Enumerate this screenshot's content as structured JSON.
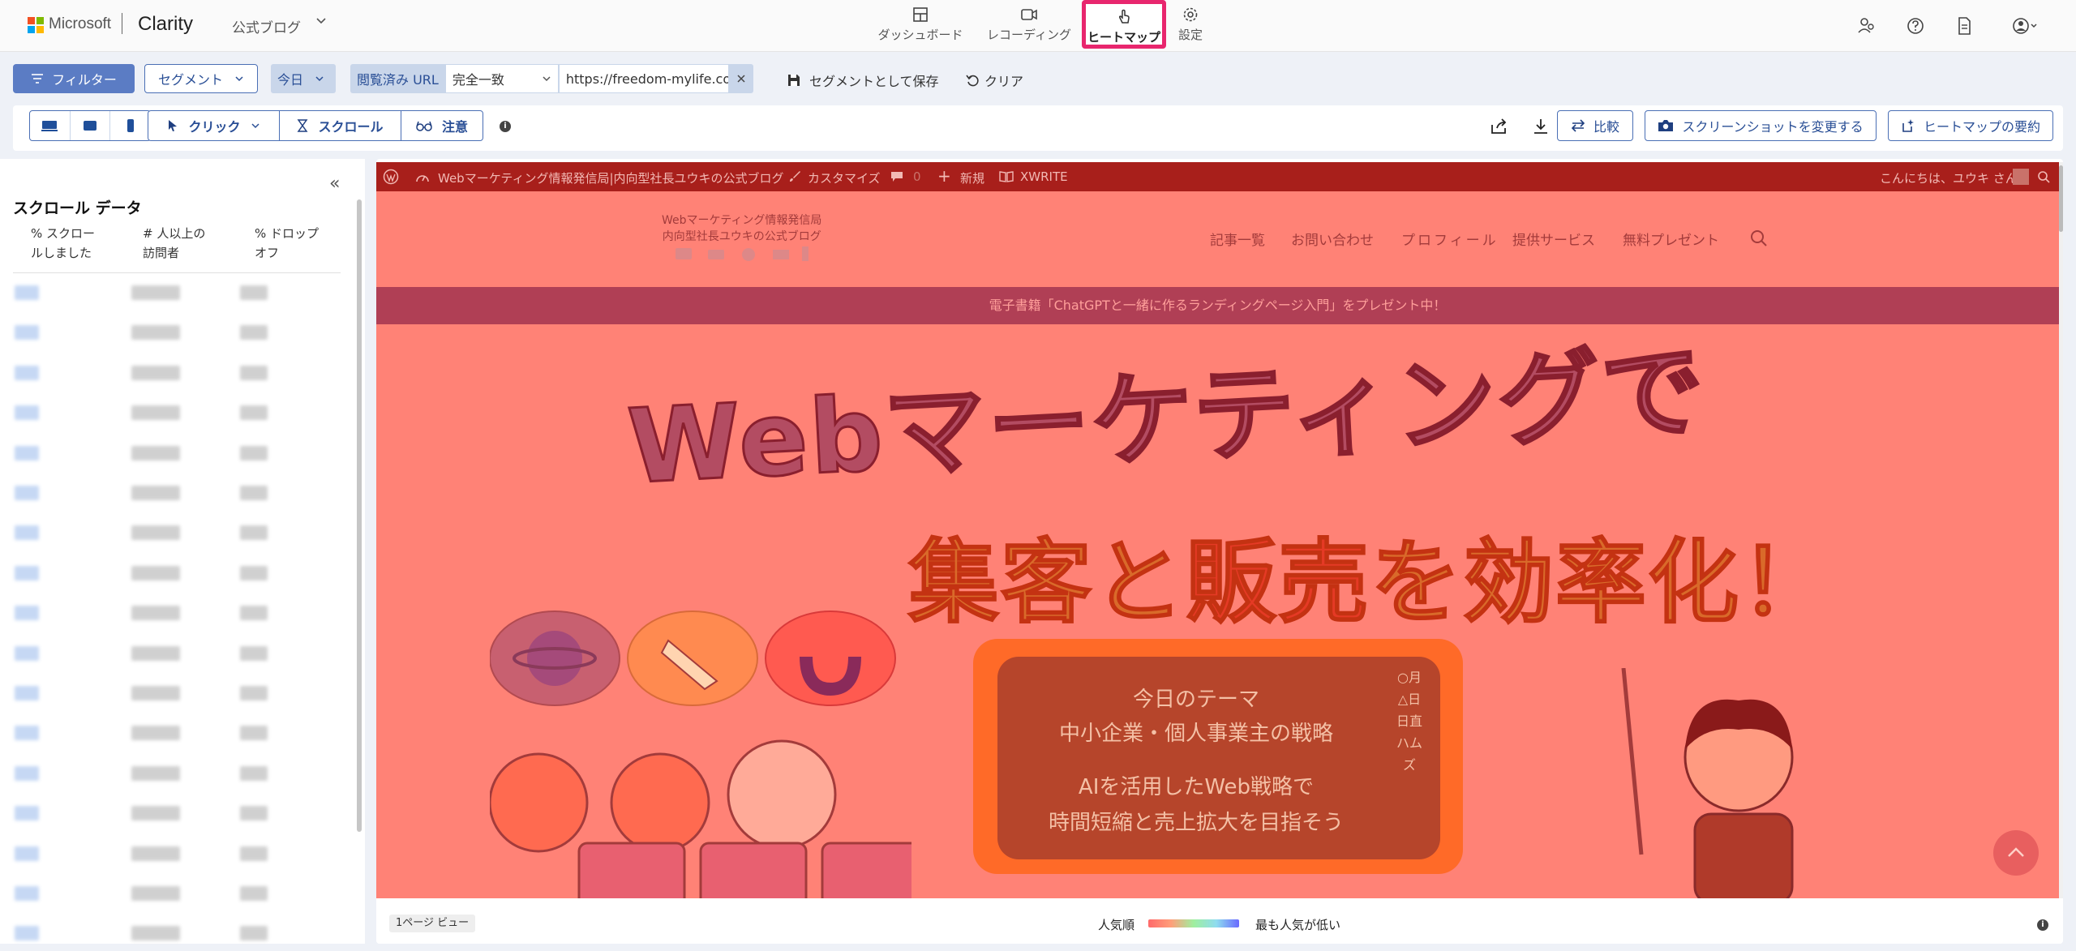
{
  "topbar": {
    "ms_text": "Microsoft",
    "brand": "Clarity",
    "project": "公式ブログ",
    "nav": [
      {
        "label": "ダッシュボード",
        "icon": "dashboard-icon"
      },
      {
        "label": "レコーディング",
        "icon": "video-camera-icon"
      },
      {
        "label": "ヒートマップ",
        "icon": "pointer-hand-icon",
        "active": true
      },
      {
        "label": "設定",
        "icon": "gear-icon"
      }
    ],
    "right_icons": [
      "people-icon",
      "help-icon",
      "document-icon",
      "account-icon"
    ]
  },
  "filterbar": {
    "filter_label": "フィルター",
    "segment_label": "セグメント",
    "date_label": "今日",
    "url_filter": {
      "label": "閲覧済み URL",
      "match": "完全一致",
      "value": "https://freedom-mylife.com/"
    },
    "save_segment": "セグメントとして保存",
    "clear": "クリア"
  },
  "toolbar": {
    "modes": [
      {
        "label": "クリック",
        "icon": "cursor-icon"
      },
      {
        "label": "スクロール",
        "icon": "scroll-icon"
      },
      {
        "label": "注意",
        "icon": "glasses-icon"
      }
    ],
    "compare": "比較",
    "change_screenshot": "スクリーンショットを変更する",
    "summary": "ヒートマップの要約"
  },
  "scroll_panel": {
    "title": "スクロール データ",
    "columns": [
      {
        "line1": "% スクロー",
        "line2": "ルしました"
      },
      {
        "line1": "# 人以上の",
        "line2": "訪問者"
      },
      {
        "line1": "% ドロップ",
        "line2": "オフ"
      }
    ]
  },
  "site": {
    "admin_bar": {
      "site_name": "Webマーケティング情報発信局|内向型社長ユウキの公式ブログ",
      "customize": "カスタマイズ",
      "comments": "0",
      "new": "新規",
      "xwrite": "XWRITE",
      "greeting": "こんにちは、ユウキ さん"
    },
    "logo_line1": "Webマーケティング情報発信局",
    "logo_line2": "内向型社長ユウキの公式ブログ",
    "nav": [
      "記事一覧",
      "お問い合わせ",
      "プロフィール",
      "提供サービス",
      "無料プレゼント"
    ],
    "banner": "電子書籍「ChatGPTと一緒に作るランディングページ入門」をプレゼント中！",
    "hero_line1": "Webマーケティングで",
    "hero_line2_a": "集客と",
    "hero_line2_b": "販売",
    "hero_line2_c": "を効率化！",
    "theme": {
      "line1": "今日のテーマ",
      "line2": "中小企業・個人事業主の戦略",
      "line3": "AIを活用したWeb戦略で",
      "line4": "時間短縮と売上拡大を目指そう",
      "vertical": "○月△日日直ハムズ"
    }
  },
  "preview_footer": {
    "page_views": "1ページ ビュー",
    "legend_left": "人気順",
    "legend_right": "最も人気が低い"
  },
  "colors": {
    "accent": "#4a6fb5",
    "active_nav_border": "#e8266e",
    "heat_overlay": "#ff8276"
  }
}
